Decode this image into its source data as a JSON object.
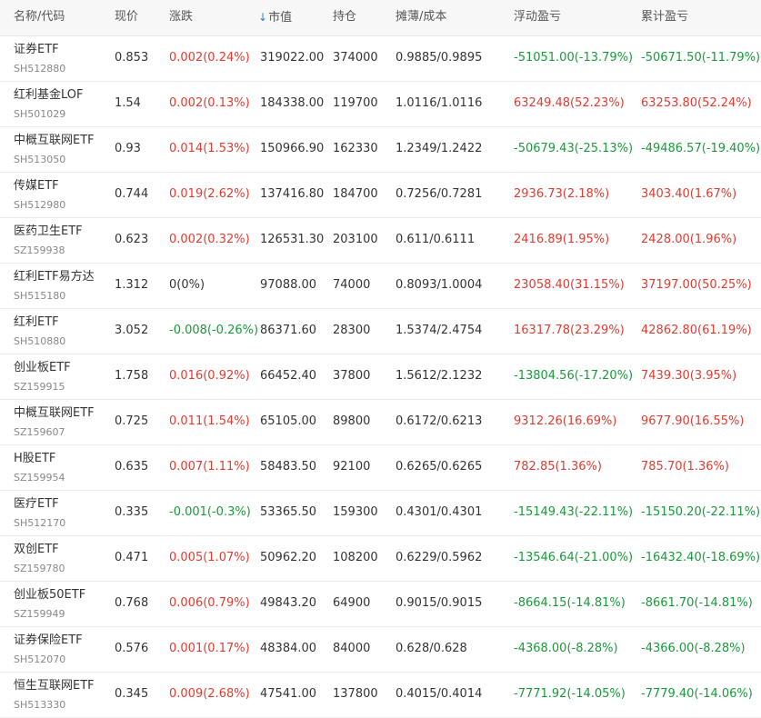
{
  "header": {
    "name_code": "名称/代码",
    "price": "现价",
    "change": "涨跌",
    "sort_arrow": "↓",
    "market_value": "市值",
    "position": "持仓",
    "cost": "摊薄/成本",
    "floating_pl": "浮动盈亏",
    "total_pl": "累计盈亏"
  },
  "rows": [
    {
      "name": "证券ETF",
      "code": "SH512880",
      "price": "0.853",
      "change": "0.002(0.24%)",
      "change_dir": "up",
      "market_value": "319022.00",
      "position": "374000",
      "cost": "0.9885/0.9895",
      "floating_pl": "-51051.00(-13.79%)",
      "floating_dir": "down",
      "total_pl": "-50671.50(-11.79%)",
      "total_dir": "down"
    },
    {
      "name": "红利基金LOF",
      "code": "SH501029",
      "price": "1.54",
      "change": "0.002(0.13%)",
      "change_dir": "up",
      "market_value": "184338.00",
      "position": "119700",
      "cost": "1.0116/1.0116",
      "floating_pl": "63249.48(52.23%)",
      "floating_dir": "up",
      "total_pl": "63253.80(52.24%)",
      "total_dir": "up"
    },
    {
      "name": "中概互联网ETF",
      "code": "SH513050",
      "price": "0.93",
      "change": "0.014(1.53%)",
      "change_dir": "up",
      "market_value": "150966.90",
      "position": "162330",
      "cost": "1.2349/1.2422",
      "floating_pl": "-50679.43(-25.13%)",
      "floating_dir": "down",
      "total_pl": "-49486.57(-19.40%)",
      "total_dir": "down"
    },
    {
      "name": "传媒ETF",
      "code": "SH512980",
      "price": "0.744",
      "change": "0.019(2.62%)",
      "change_dir": "up",
      "market_value": "137416.80",
      "position": "184700",
      "cost": "0.7256/0.7281",
      "floating_pl": "2936.73(2.18%)",
      "floating_dir": "up",
      "total_pl": "3403.40(1.67%)",
      "total_dir": "up"
    },
    {
      "name": "医药卫生ETF",
      "code": "SZ159938",
      "price": "0.623",
      "change": "0.002(0.32%)",
      "change_dir": "up",
      "market_value": "126531.30",
      "position": "203100",
      "cost": "0.611/0.6111",
      "floating_pl": "2416.89(1.95%)",
      "floating_dir": "up",
      "total_pl": "2428.00(1.96%)",
      "total_dir": "up"
    },
    {
      "name": "红利ETF易方达",
      "code": "SH515180",
      "price": "1.312",
      "change": "0(0%)",
      "change_dir": "flat",
      "market_value": "97088.00",
      "position": "74000",
      "cost": "0.8093/1.0004",
      "floating_pl": "23058.40(31.15%)",
      "floating_dir": "up",
      "total_pl": "37197.00(50.25%)",
      "total_dir": "up"
    },
    {
      "name": "红利ETF",
      "code": "SH510880",
      "price": "3.052",
      "change": "-0.008(-0.26%)",
      "change_dir": "down",
      "market_value": "86371.60",
      "position": "28300",
      "cost": "1.5374/2.4754",
      "floating_pl": "16317.78(23.29%)",
      "floating_dir": "up",
      "total_pl": "42862.80(61.19%)",
      "total_dir": "up"
    },
    {
      "name": "创业板ETF",
      "code": "SZ159915",
      "price": "1.758",
      "change": "0.016(0.92%)",
      "change_dir": "up",
      "market_value": "66452.40",
      "position": "37800",
      "cost": "1.5612/2.1232",
      "floating_pl": "-13804.56(-17.20%)",
      "floating_dir": "down",
      "total_pl": "7439.30(3.95%)",
      "total_dir": "up"
    },
    {
      "name": "中概互联网ETF",
      "code": "SZ159607",
      "price": "0.725",
      "change": "0.011(1.54%)",
      "change_dir": "up",
      "market_value": "65105.00",
      "position": "89800",
      "cost": "0.6172/0.6213",
      "floating_pl": "9312.26(16.69%)",
      "floating_dir": "up",
      "total_pl": "9677.90(16.55%)",
      "total_dir": "up"
    },
    {
      "name": "H股ETF",
      "code": "SZ159954",
      "price": "0.635",
      "change": "0.007(1.11%)",
      "change_dir": "up",
      "market_value": "58483.50",
      "position": "92100",
      "cost": "0.6265/0.6265",
      "floating_pl": "782.85(1.36%)",
      "floating_dir": "up",
      "total_pl": "785.70(1.36%)",
      "total_dir": "up"
    },
    {
      "name": "医疗ETF",
      "code": "SH512170",
      "price": "0.335",
      "change": "-0.001(-0.3%)",
      "change_dir": "down",
      "market_value": "53365.50",
      "position": "159300",
      "cost": "0.4301/0.4301",
      "floating_pl": "-15149.43(-22.11%)",
      "floating_dir": "down",
      "total_pl": "-15150.20(-22.11%)",
      "total_dir": "down"
    },
    {
      "name": "双创ETF",
      "code": "SZ159780",
      "price": "0.471",
      "change": "0.005(1.07%)",
      "change_dir": "up",
      "market_value": "50962.20",
      "position": "108200",
      "cost": "0.6229/0.5962",
      "floating_pl": "-13546.64(-21.00%)",
      "floating_dir": "down",
      "total_pl": "-16432.40(-18.69%)",
      "total_dir": "down"
    },
    {
      "name": "创业板50ETF",
      "code": "SZ159949",
      "price": "0.768",
      "change": "0.006(0.79%)",
      "change_dir": "up",
      "market_value": "49843.20",
      "position": "64900",
      "cost": "0.9015/0.9015",
      "floating_pl": "-8664.15(-14.81%)",
      "floating_dir": "down",
      "total_pl": "-8661.70(-14.81%)",
      "total_dir": "down"
    },
    {
      "name": "证券保险ETF",
      "code": "SH512070",
      "price": "0.576",
      "change": "0.001(0.17%)",
      "change_dir": "up",
      "market_value": "48384.00",
      "position": "84000",
      "cost": "0.628/0.628",
      "floating_pl": "-4368.00(-8.28%)",
      "floating_dir": "down",
      "total_pl": "-4366.00(-8.28%)",
      "total_dir": "down"
    },
    {
      "name": "恒生互联网ETF",
      "code": "SH513330",
      "price": "0.345",
      "change": "0.009(2.68%)",
      "change_dir": "up",
      "market_value": "47541.00",
      "position": "137800",
      "cost": "0.4015/0.4014",
      "floating_pl": "-7771.92(-14.05%)",
      "floating_dir": "down",
      "total_pl": "-7779.40(-14.06%)",
      "total_dir": "down"
    }
  ],
  "colors": {
    "up": "#e03c31",
    "down": "#1a9a3a",
    "header_bg": "#f7f7f7",
    "sort_arrow": "#2d7fd9"
  }
}
